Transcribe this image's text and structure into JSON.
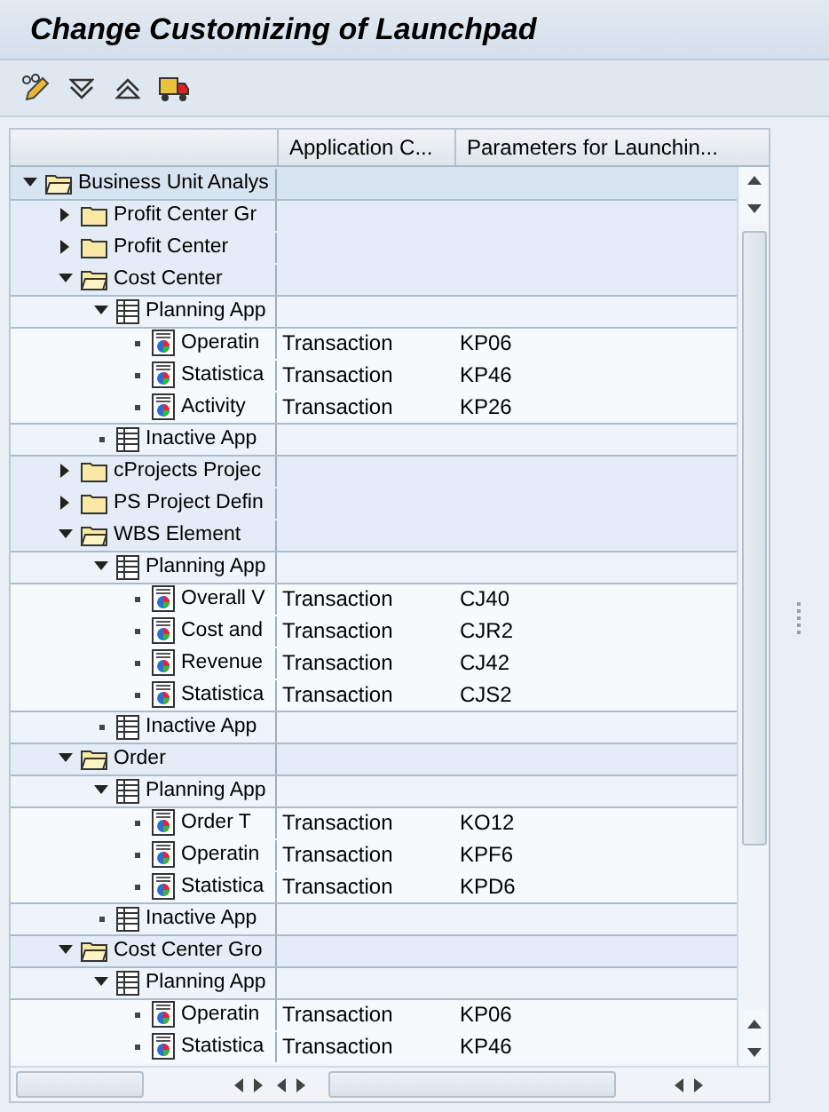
{
  "window": {
    "title": "Change Customizing of Launchpad"
  },
  "table": {
    "columns": [
      {
        "label": "Application C..."
      },
      {
        "label": "Parameters for Launchin..."
      }
    ],
    "tree": [
      {
        "label": "Business Unit Analys",
        "kind": "folder",
        "expanded": true,
        "children": [
          {
            "label": "Profit Center Gr",
            "kind": "folder",
            "expanded": false
          },
          {
            "label": "Profit Center",
            "kind": "folder",
            "expanded": false
          },
          {
            "label": "Cost Center",
            "kind": "folder",
            "expanded": true,
            "children": [
              {
                "label": "Planning App",
                "kind": "group",
                "expanded": true,
                "children": [
                  {
                    "label": "Operatin",
                    "kind": "app",
                    "app_type": "Transaction",
                    "parameter": "KP06"
                  },
                  {
                    "label": "Statistica",
                    "kind": "app",
                    "app_type": "Transaction",
                    "parameter": "KP46"
                  },
                  {
                    "label": "Activity",
                    "kind": "app",
                    "app_type": "Transaction",
                    "parameter": "KP26"
                  }
                ]
              },
              {
                "label": "Inactive App",
                "kind": "group"
              }
            ]
          },
          {
            "label": "cProjects Projec",
            "kind": "folder",
            "expanded": false
          },
          {
            "label": "PS Project Defin",
            "kind": "folder",
            "expanded": false
          },
          {
            "label": "WBS Element",
            "kind": "folder",
            "expanded": true,
            "children": [
              {
                "label": "Planning App",
                "kind": "group",
                "expanded": true,
                "children": [
                  {
                    "label": "Overall V",
                    "kind": "app",
                    "app_type": "Transaction",
                    "parameter": "CJ40"
                  },
                  {
                    "label": "Cost and",
                    "kind": "app",
                    "app_type": "Transaction",
                    "parameter": "CJR2"
                  },
                  {
                    "label": "Revenue",
                    "kind": "app",
                    "app_type": "Transaction",
                    "parameter": "CJ42"
                  },
                  {
                    "label": "Statistica",
                    "kind": "app",
                    "app_type": "Transaction",
                    "parameter": "CJS2"
                  }
                ]
              },
              {
                "label": "Inactive App",
                "kind": "group"
              }
            ]
          },
          {
            "label": "Order",
            "kind": "folder",
            "expanded": true,
            "children": [
              {
                "label": "Planning App",
                "kind": "group",
                "expanded": true,
                "children": [
                  {
                    "label": "Order T",
                    "kind": "app",
                    "app_type": "Transaction",
                    "parameter": "KO12"
                  },
                  {
                    "label": "Operatin",
                    "kind": "app",
                    "app_type": "Transaction",
                    "parameter": "KPF6"
                  },
                  {
                    "label": "Statistica",
                    "kind": "app",
                    "app_type": "Transaction",
                    "parameter": "KPD6"
                  }
                ]
              },
              {
                "label": "Inactive App",
                "kind": "group"
              }
            ]
          },
          {
            "label": "Cost Center Gro",
            "kind": "folder",
            "expanded": true,
            "children": [
              {
                "label": "Planning App",
                "kind": "group",
                "expanded": true,
                "children": [
                  {
                    "label": "Operatin",
                    "kind": "app",
                    "app_type": "Transaction",
                    "parameter": "KP06"
                  },
                  {
                    "label": "Statistica",
                    "kind": "app",
                    "app_type": "Transaction",
                    "parameter": "KP46"
                  }
                ]
              }
            ]
          }
        ]
      }
    ]
  }
}
